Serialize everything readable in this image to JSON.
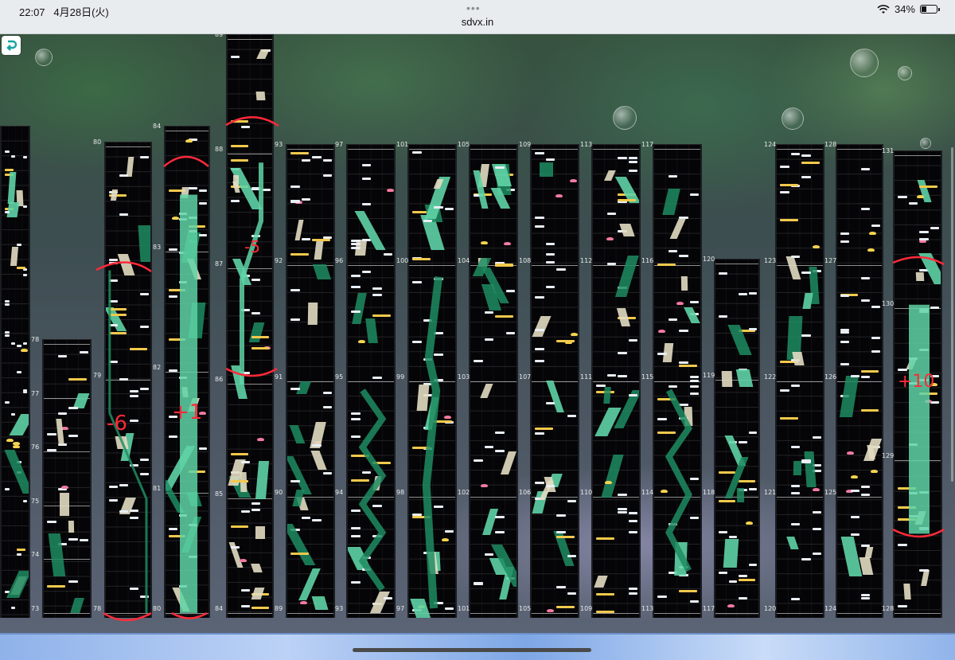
{
  "status_bar": {
    "time": "22:07",
    "date": "4月28日(火)",
    "dots": "•••",
    "url": "sdvx.in",
    "battery": "34%",
    "battery_level": 0.34
  },
  "colors": {
    "hold_bright": "#5fd3a6",
    "hold_dark": "#1f8c61",
    "fx_yellow": "#f2c94c",
    "annotation_red": "#ff2a3a"
  },
  "icons": {
    "back": "back-arrow-icon",
    "wifi": "wifi-icon",
    "battery": "battery-icon"
  },
  "columns": [
    {
      "id": "c0",
      "labels": []
    },
    {
      "id": "c1",
      "labels": [
        "78",
        "77",
        "76",
        "75",
        "74",
        "73"
      ]
    },
    {
      "id": "c2",
      "labels": [
        "80",
        "79",
        "78"
      ]
    },
    {
      "id": "c3",
      "labels": [
        "84",
        "83",
        "82",
        "81",
        "80"
      ]
    },
    {
      "id": "c4",
      "labels": [
        "89",
        "88",
        "87",
        "86",
        "85",
        "84"
      ]
    },
    {
      "id": "c5",
      "labels": [
        "93",
        "92",
        "91",
        "90",
        "89"
      ]
    },
    {
      "id": "c6",
      "labels": [
        "97",
        "96",
        "95",
        "94",
        "93"
      ]
    },
    {
      "id": "c7",
      "labels": [
        "101",
        "100",
        "99",
        "98",
        "97"
      ]
    },
    {
      "id": "c8",
      "labels": [
        "105",
        "104",
        "103",
        "102",
        "101"
      ]
    },
    {
      "id": "c9",
      "labels": [
        "109",
        "108",
        "107",
        "106",
        "105"
      ]
    },
    {
      "id": "c10",
      "labels": [
        "113",
        "112",
        "111",
        "110",
        "109"
      ]
    },
    {
      "id": "c11",
      "labels": [
        "117",
        "116",
        "115",
        "114",
        "113"
      ]
    },
    {
      "id": "c12",
      "labels": [
        "120",
        "119",
        "118",
        "117"
      ]
    },
    {
      "id": "c13",
      "labels": [
        "124",
        "123",
        "122",
        "121",
        "120"
      ]
    },
    {
      "id": "c14",
      "labels": [
        "128",
        "127",
        "126",
        "125",
        "124"
      ]
    },
    {
      "id": "c15",
      "labels": [
        "131",
        "130",
        "129",
        "128"
      ]
    }
  ],
  "annotations": {
    "a1": "-6",
    "a2": "+1",
    "a3": "-5",
    "a4": "+10"
  }
}
